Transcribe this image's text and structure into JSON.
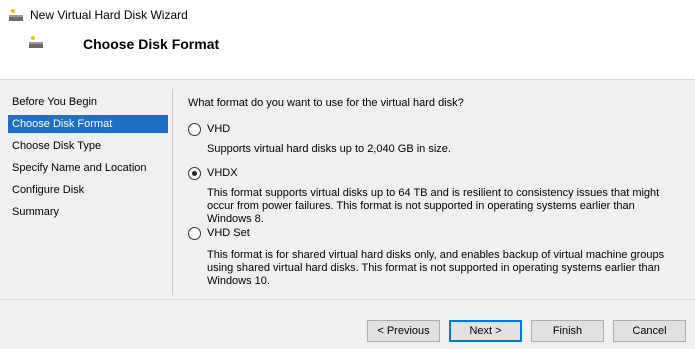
{
  "window": {
    "title": "New Virtual Hard Disk Wizard"
  },
  "header": {
    "title": "Choose Disk Format"
  },
  "nav": {
    "items": [
      {
        "label": "Before You Begin"
      },
      {
        "label": "Choose Disk Format",
        "active": true
      },
      {
        "label": "Choose Disk Type"
      },
      {
        "label": "Specify Name and Location"
      },
      {
        "label": "Configure Disk"
      },
      {
        "label": "Summary"
      }
    ]
  },
  "content": {
    "question": "What format do you want to use for the virtual hard disk?",
    "options": [
      {
        "label": "VHD",
        "checked": false,
        "description": "Supports virtual hard disks up to 2,040 GB in size."
      },
      {
        "label": "VHDX",
        "checked": true,
        "description": "This format supports virtual disks up to 64 TB and is resilient to consistency issues that might occur from power failures. This format is not supported in operating systems earlier than Windows 8."
      },
      {
        "label": "VHD Set",
        "checked": false,
        "description": "This format is for shared virtual hard disks only, and enables backup of virtual machine groups using shared virtual hard disks. This format is not supported in operating systems earlier than Windows 10."
      }
    ]
  },
  "footer": {
    "previous_label": "< Previous",
    "next_label": "Next >",
    "finish_label": "Finish",
    "cancel_label": "Cancel"
  },
  "colors": {
    "selection": "#1f6fc4",
    "background": "#f0f0f0",
    "header_background": "#ffffff"
  },
  "icons": {
    "title_icon": "virtual-disk-icon",
    "header_icon": "virtual-disk-icon"
  }
}
